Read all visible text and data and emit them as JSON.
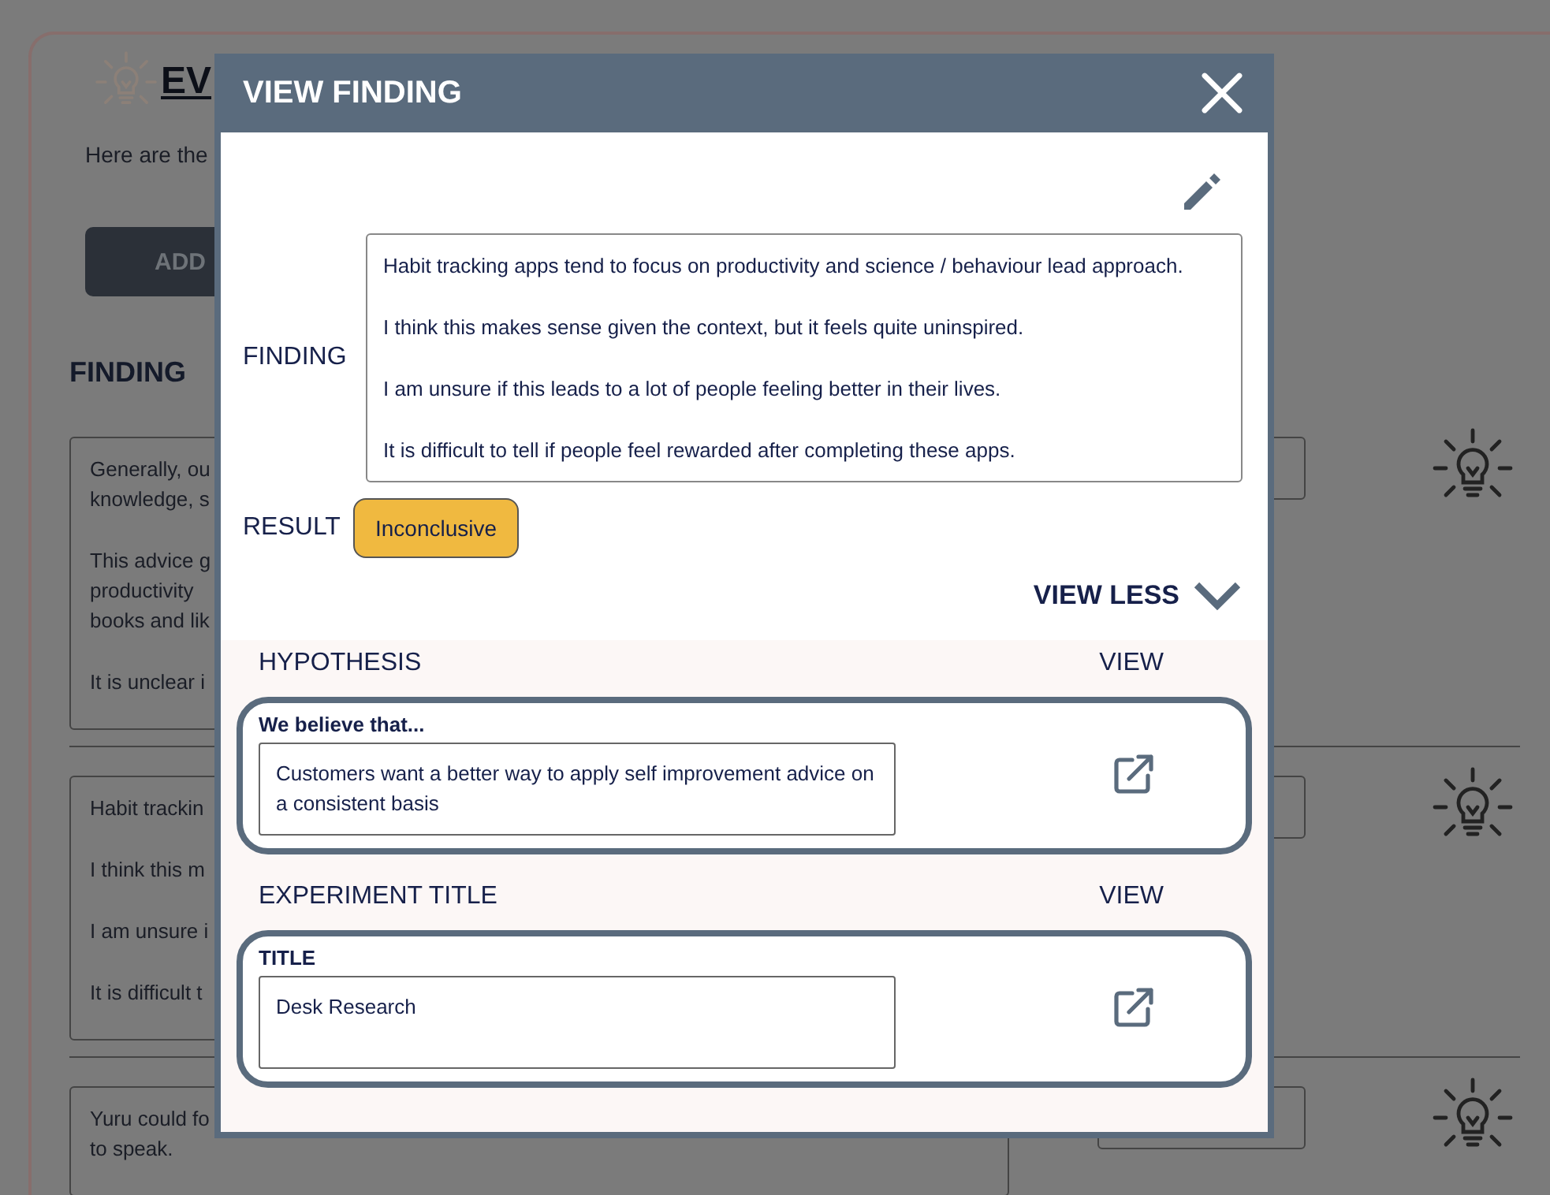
{
  "page": {
    "heading": "EV",
    "intro": "Here are the",
    "add_button": "ADD",
    "section_title": "FINDING",
    "findings": [
      {
        "paragraphs": [
          [
            "Generally, ou",
            "knowledge, s"
          ],
          [
            "This advice g",
            "productivity",
            "books and lik"
          ],
          [
            "It is unclear i"
          ]
        ]
      },
      {
        "paragraphs": [
          [
            "Habit trackin"
          ],
          [
            "I think this m"
          ],
          [
            "I am unsure i"
          ],
          [
            "It is difficult t"
          ]
        ]
      },
      {
        "paragraphs": [
          [
            "Yuru could fo",
            "to speak."
          ]
        ]
      }
    ]
  },
  "modal": {
    "title": "VIEW FINDING",
    "finding_label": "FINDING",
    "finding_paragraphs": [
      "Habit tracking apps tend to focus on productivity and science / behaviour lead approach.",
      "I think this makes sense given the context, but it feels quite uninspired.",
      "I am unsure if this leads to a lot of people feeling better in their lives.",
      "It is difficult to tell if people feel rewarded after completing these apps."
    ],
    "result_label": "RESULT",
    "result": "Inconclusive",
    "toggle": "VIEW LESS",
    "links": [
      {
        "heading": "HYPOTHESIS",
        "action": "VIEW",
        "label": "We believe that...",
        "value": "Customers want a better way to apply self improvement advice on a consistent basis"
      },
      {
        "heading": "EXPERIMENT TITLE",
        "action": "VIEW",
        "label": "TITLE",
        "value": "Desk Research"
      }
    ]
  }
}
